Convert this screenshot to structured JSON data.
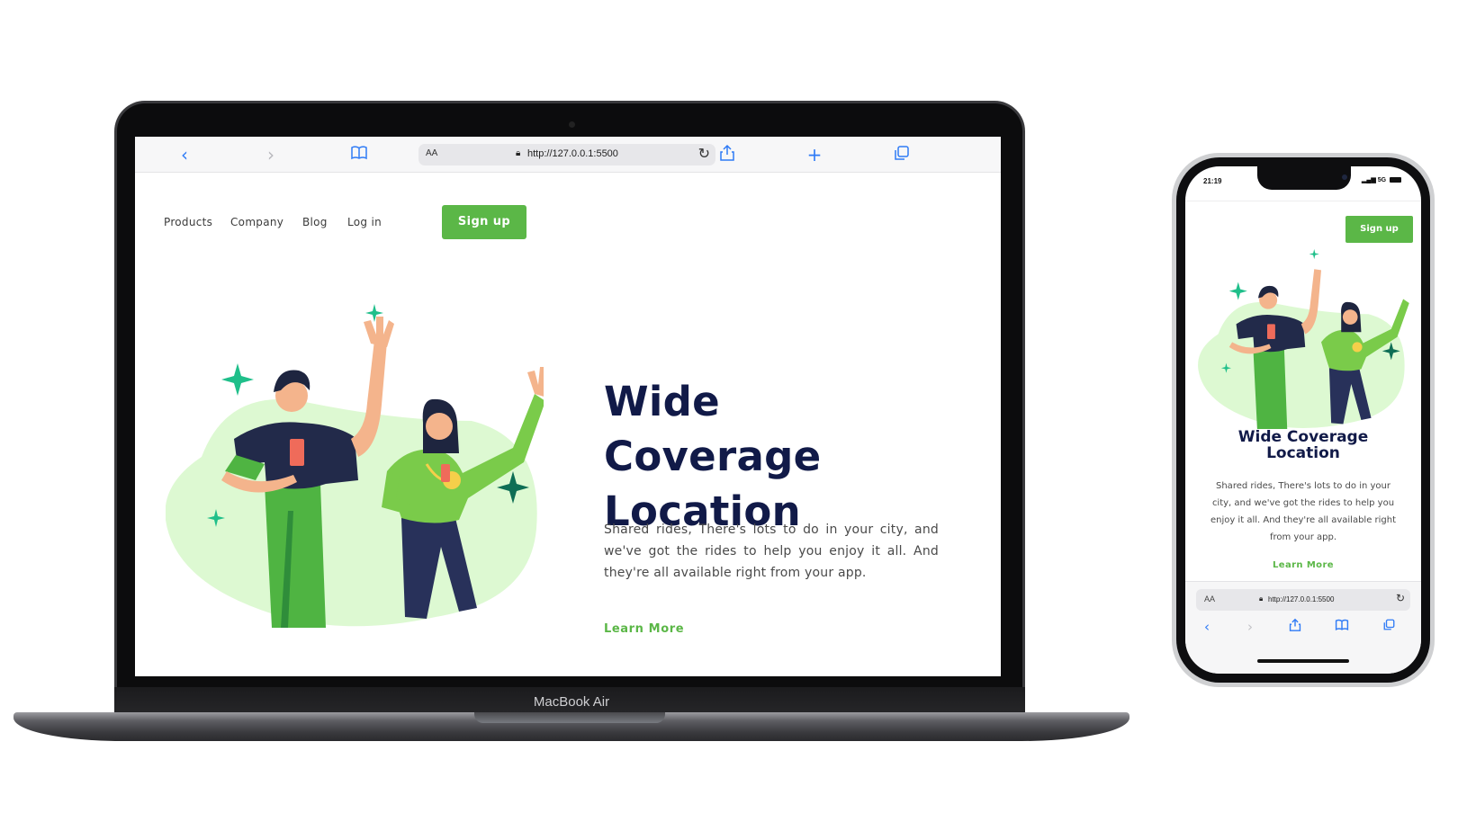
{
  "laptop": {
    "brand": "MacBook Air",
    "browser": {
      "text_size_label": "AA",
      "url": "http://127.0.0.1:5500",
      "icons": [
        "chevron-left-icon",
        "chevron-right-icon",
        "book-icon",
        "lock-icon",
        "reload-icon",
        "share-icon",
        "plus-icon",
        "tabs-icon"
      ]
    },
    "page": {
      "nav": {
        "links": [
          "Products",
          "Company",
          "Blog",
          "Log in"
        ],
        "signup_label": "Sign up"
      },
      "hero": {
        "title_line1": "Wide Coverage",
        "title_line2": "Location",
        "description": "Shared rides, There's lots to do in your city, and we've got the rides to help you enjoy it all. And they're all available right from your app.",
        "link_label": "Learn More"
      }
    }
  },
  "phone": {
    "status": {
      "time": "21:19",
      "network": "5G"
    },
    "page": {
      "signup_label": "Sign up",
      "title_line1": "Wide Coverage",
      "title_line2": "Location",
      "description": "Shared rides, There's lots to do in your city, and we've got the rides to help you enjoy it all. And they're all available right from your app.",
      "link_label": "Learn More"
    },
    "browser": {
      "text_size_label": "AA",
      "url": "http://127.0.0.1:5500"
    }
  },
  "colors": {
    "accent_green": "#5bb747",
    "title_navy": "#111a48",
    "blob_green": "#ddf9d2",
    "sparkle_teal": "#1fbf8a",
    "safari_blue": "#2f7bf6"
  }
}
